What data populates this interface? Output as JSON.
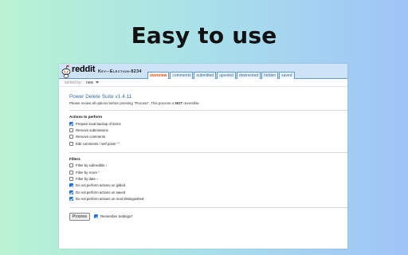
{
  "headline": "Easy to use",
  "reddit": {
    "wordmark": "reddit",
    "subreddit": "Key--Election-8234",
    "tabs": [
      "overview",
      "comments",
      "submitted",
      "upvoted",
      "downvoted",
      "hidden",
      "saved"
    ],
    "active_tab": "overview",
    "sort_label": "sorted by:",
    "sort_value": "new"
  },
  "panel": {
    "title": "Power Delete Suite v1.4.11",
    "desc_pre": "Please review all options before pressing \"Process\". This process is ",
    "desc_bold": "NOT",
    "desc_post": " reversible.",
    "actions": {
      "title": "Actions to perform",
      "items": [
        {
          "label": "Prepare local backup of items",
          "checked": true,
          "help": ""
        },
        {
          "label": "Remove submissions",
          "checked": false,
          "help": ""
        },
        {
          "label": "Remove comments",
          "checked": false,
          "help": ""
        },
        {
          "label": "Edit comments / self posts",
          "checked": false,
          "help": "»?"
        }
      ]
    },
    "filters": {
      "title": "Filters",
      "items": [
        {
          "label": "Filter by subreddits",
          "checked": false,
          "help": "»"
        },
        {
          "label": "Filter by score",
          "checked": false,
          "help": "»"
        },
        {
          "label": "Filter by date",
          "checked": false,
          "help": "»"
        },
        {
          "label": "Do not perform actions on gilded",
          "checked": true,
          "help": ""
        },
        {
          "label": "Do not perform actions on saved",
          "checked": true,
          "help": ""
        },
        {
          "label": "Do not perform actions on mod distinguished",
          "checked": true,
          "help": ""
        }
      ]
    },
    "process_label": "Process",
    "remember_label": "Remember Settings?",
    "remember_checked": true
  }
}
